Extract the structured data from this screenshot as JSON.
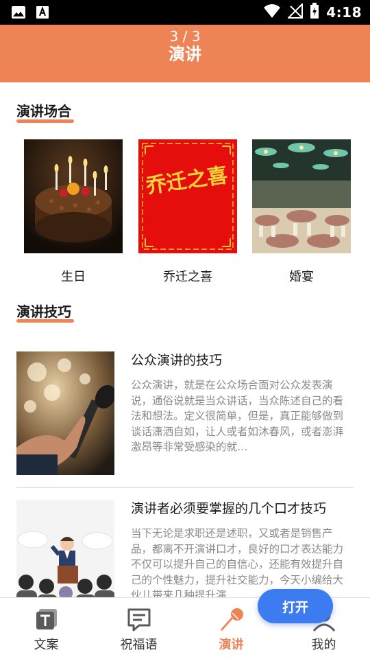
{
  "status_bar": {
    "time": "4:18",
    "icons": [
      "image-icon",
      "text-a-icon",
      "wifi-icon",
      "no-signal-icon",
      "battery-charging-icon"
    ]
  },
  "header": {
    "page_indicator": "3 / 3",
    "title": "演讲"
  },
  "occasions_section": {
    "title": "演讲场合",
    "items": [
      {
        "label": "生日",
        "image": "birthday-cake-image"
      },
      {
        "label": "乔迁之喜",
        "image": "housewarming-card-image",
        "art_text": "乔迁之喜"
      },
      {
        "label": "婚宴",
        "image": "wedding-banquet-image"
      }
    ]
  },
  "tips_section": {
    "title": "演讲技巧",
    "articles": [
      {
        "title": "公众演讲的技巧",
        "summary": "公众演讲，就是在公众场合面对公众发表演说，通俗说就是当众讲话，当众陈述自己的看法和想法。定义很简单，但是，真正能够做到谈话潇洒自如，让人或者如沐春风，或者澎湃激昂等非常受感染的就…",
        "image": "microphone-speaker-image"
      },
      {
        "title": "演讲者必须要掌握的几个口才技巧",
        "summary": "当下无论是求职还是述职，又或者是销售产品，都离不开演讲口才，良好的口才表达能力不仅可以提升自己的自信心，还能有效提升自己的个性魅力，提升社交能力，今天小编给大伙儿带来几种提升演…",
        "image": "speaker-audience-image"
      }
    ]
  },
  "floating_button": {
    "label": "打开"
  },
  "bottom_nav": {
    "items": [
      {
        "label": "文案",
        "icon": "text-document-icon",
        "active": false
      },
      {
        "label": "祝福语",
        "icon": "message-bubble-icon",
        "active": false
      },
      {
        "label": "演讲",
        "icon": "microphone-icon",
        "active": true
      },
      {
        "label": "我的",
        "icon": "person-icon",
        "active": false
      }
    ]
  },
  "colors": {
    "accent": "#ee8355",
    "button_blue": "#3d7bf0",
    "status_bar": "#000000"
  }
}
